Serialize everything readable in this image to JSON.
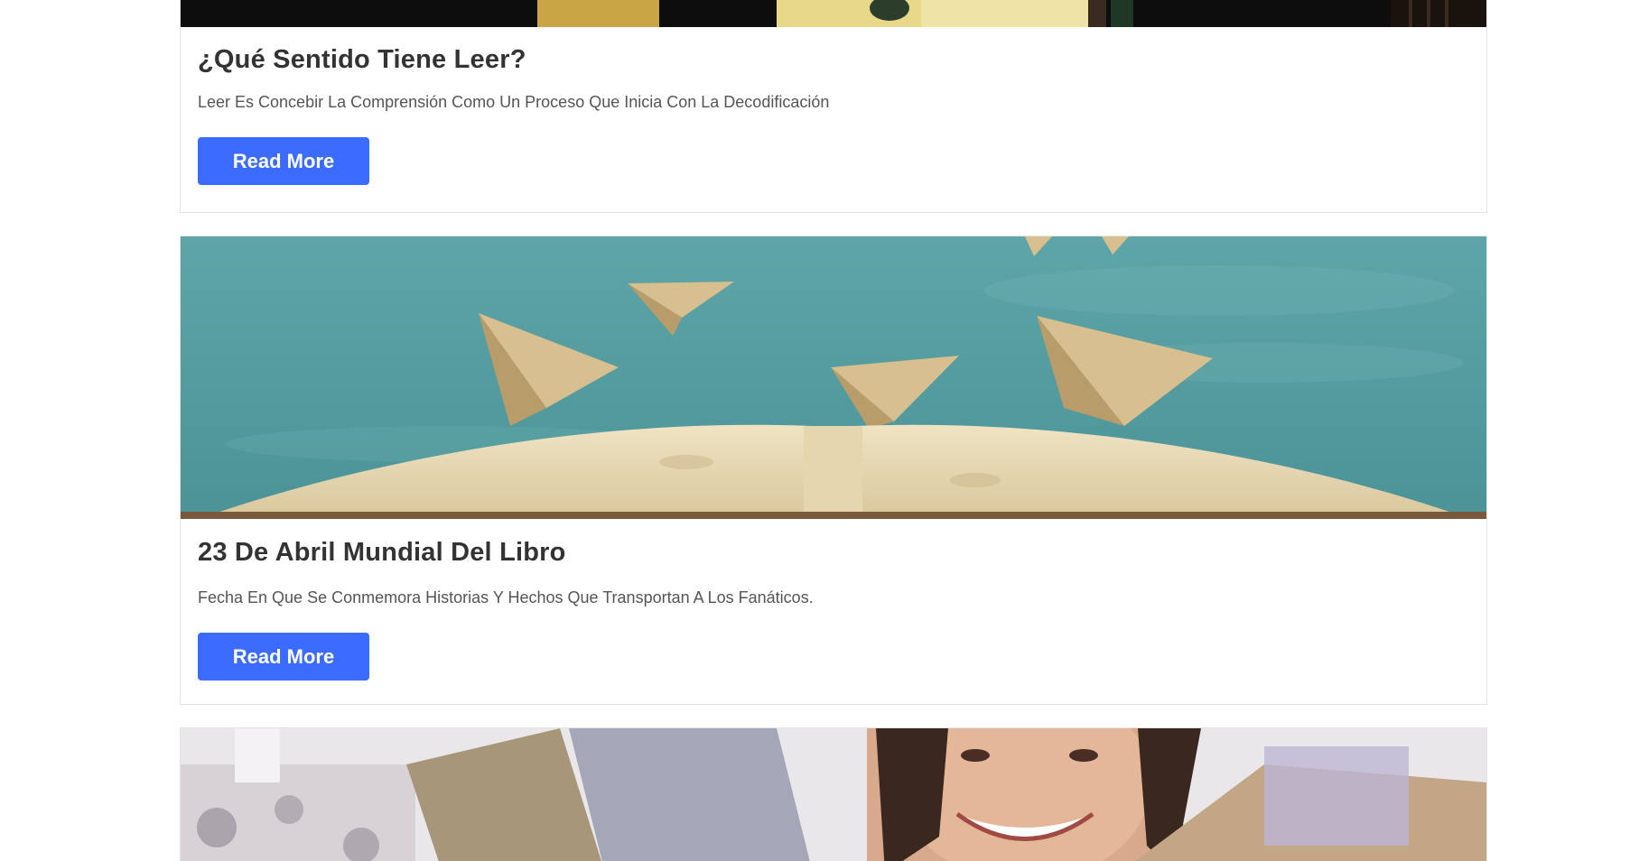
{
  "posts": [
    {
      "title": "¿Qué Sentido Tiene Leer?",
      "excerpt": "Leer Es Concebir La Comprensión Como Un Proceso Que Inicia Con La Decodificación",
      "button_label": "Read More"
    },
    {
      "title": "23 De Abril Mundial Del Libro",
      "excerpt": "Fecha En Que Se Conmemora Historias Y Hechos Que Transportan A Los Fanáticos.",
      "button_label": "Read More"
    },
    {
      "title": "",
      "excerpt": "",
      "button_label": ""
    }
  ],
  "colors": {
    "accent": "#3b6cff",
    "title": "#333333",
    "text": "#555555",
    "border": "#e3e3e3"
  }
}
